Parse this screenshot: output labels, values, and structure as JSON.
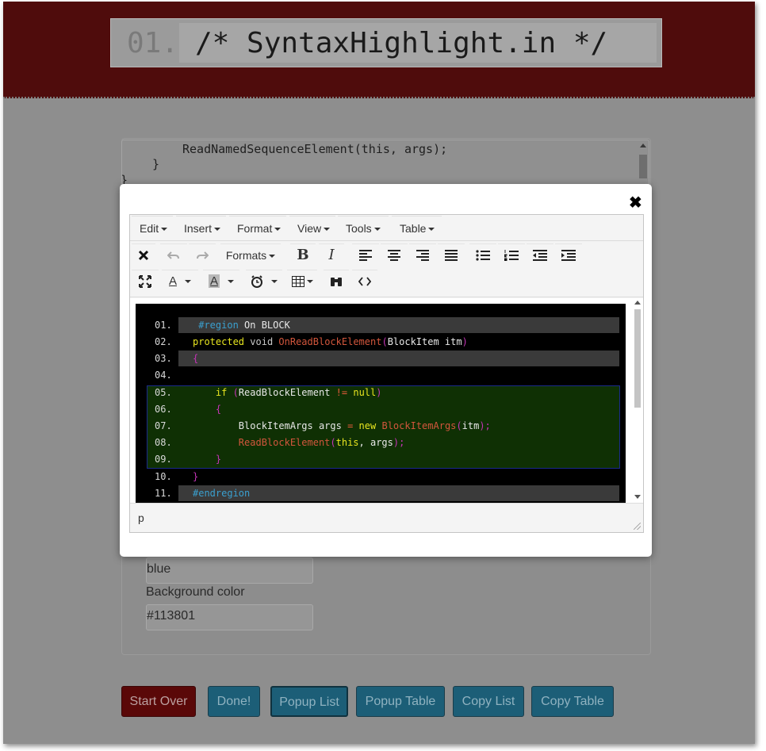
{
  "header": {
    "line_number": "01.",
    "title": "/* SyntaxHighlight.in */"
  },
  "background_code": {
    "line1": "ReadNamedSequenceElement(this, args);",
    "line2": "}",
    "line3": "}"
  },
  "background_form": {
    "font_color_value": "blue",
    "background_color_label": "Background color",
    "background_color_value": "#113801"
  },
  "buttons": {
    "start_over": "Start Over",
    "done": "Done!",
    "popup_list": "Popup List",
    "popup_table": "Popup Table",
    "copy_list": "Copy List",
    "copy_table": "Copy Table"
  },
  "modal": {
    "close_glyph": "✖"
  },
  "editor": {
    "menu": [
      "Edit",
      "Insert",
      "Format",
      "View",
      "Tools",
      "Table"
    ],
    "formats_label": "Formats",
    "status_path": "p",
    "code_lines": [
      {
        "num": "01.",
        "tokens": [
          [
            "c-pp",
            " #region"
          ],
          [
            "c-pl",
            " On BLOCK"
          ]
        ],
        "shade": true
      },
      {
        "num": "02.",
        "tokens": [
          [
            "c-kw",
            "protected"
          ],
          [
            "c-pl",
            " "
          ],
          [
            "c-kw2",
            "void"
          ],
          [
            "c-pl",
            " "
          ],
          [
            "c-fn",
            "OnReadBlockElement"
          ],
          [
            "c-br",
            "("
          ],
          [
            "c-pl",
            "BlockItem itm"
          ],
          [
            "c-br",
            ")"
          ]
        ],
        "shade": false
      },
      {
        "num": "03.",
        "tokens": [
          [
            "c-br",
            "{"
          ]
        ],
        "shade": true
      },
      {
        "num": "04.",
        "tokens": [],
        "shade": false
      },
      {
        "num": "05.",
        "tokens": [
          [
            "c-pl",
            "    "
          ],
          [
            "c-kw",
            "if"
          ],
          [
            "c-pl",
            " "
          ],
          [
            "c-br",
            "("
          ],
          [
            "c-pl",
            "ReadBlockElement "
          ],
          [
            "c-op",
            "!="
          ],
          [
            "c-pl",
            " "
          ],
          [
            "c-kw",
            "null"
          ],
          [
            "c-br",
            ")"
          ]
        ],
        "shade": false
      },
      {
        "num": "06.",
        "tokens": [
          [
            "c-pl",
            "    "
          ],
          [
            "c-br",
            "{"
          ]
        ],
        "shade": false
      },
      {
        "num": "07.",
        "tokens": [
          [
            "c-pl",
            "        BlockItemArgs args "
          ],
          [
            "c-op",
            "="
          ],
          [
            "c-pl",
            " "
          ],
          [
            "c-kw",
            "new"
          ],
          [
            "c-pl",
            " "
          ],
          [
            "c-fn",
            "BlockItemArgs"
          ],
          [
            "c-br",
            "("
          ],
          [
            "c-pl",
            "itm"
          ],
          [
            "c-br",
            ");"
          ]
        ],
        "shade": false
      },
      {
        "num": "08.",
        "tokens": [
          [
            "c-pl",
            "        "
          ],
          [
            "c-fn",
            "ReadBlockElement"
          ],
          [
            "c-br",
            "("
          ],
          [
            "c-kw",
            "this"
          ],
          [
            "c-pl",
            ", args"
          ],
          [
            "c-br",
            ");"
          ]
        ],
        "shade": false
      },
      {
        "num": "09.",
        "tokens": [
          [
            "c-pl",
            "    "
          ],
          [
            "c-br",
            "}"
          ]
        ],
        "shade": false
      },
      {
        "num": "10.",
        "tokens": [
          [
            "c-br",
            "}"
          ]
        ],
        "shade": false
      },
      {
        "num": "11.",
        "tokens": [
          [
            "c-pp",
            "#endregion"
          ]
        ],
        "shade": true
      }
    ]
  },
  "colors": {
    "header_bg": "#4f0c0c",
    "highlight_bg": "#113801",
    "keyword": "#e7e51f",
    "function": "#d2563c",
    "preprocessor": "#3aa0cf"
  }
}
